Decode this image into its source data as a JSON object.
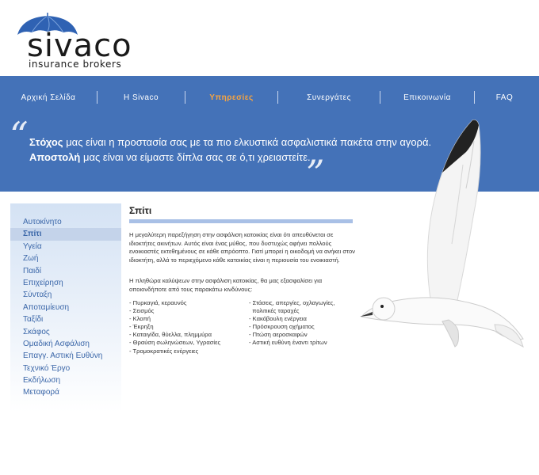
{
  "logo": {
    "brand": "sivaco",
    "tagline": "insurance brokers"
  },
  "nav": {
    "items": [
      {
        "label": "Αρχική Σελίδα",
        "active": false
      },
      {
        "label": "Η Sivaco",
        "active": false
      },
      {
        "label": "Υπηρεσίες",
        "active": true
      },
      {
        "label": "Συνεργάτες",
        "active": false
      },
      {
        "label": "Επικοινωνία",
        "active": false
      },
      {
        "label": "FAQ",
        "active": false
      }
    ]
  },
  "slogan": {
    "line1_bold": "Στόχος",
    "line1_rest": " μας είναι η προστασία σας με τα πιο ελκυστικά ασφαλιστικά πακέτα στην αγορά.",
    "line2_bold": "Αποστολή",
    "line2_rest": " μας είναι να είμαστε δίπλα σας σε ό,τι χρειαστείτε."
  },
  "sidebar": {
    "items": [
      {
        "label": "Αυτοκίνητο",
        "active": false
      },
      {
        "label": "Σπίτι",
        "active": true
      },
      {
        "label": "Υγεία",
        "active": false
      },
      {
        "label": "Ζωή",
        "active": false
      },
      {
        "label": "Παιδί",
        "active": false
      },
      {
        "label": "Επιχείρηση",
        "active": false
      },
      {
        "label": "Σύνταξη",
        "active": false
      },
      {
        "label": "Αποταμίευση",
        "active": false
      },
      {
        "label": "Ταξίδι",
        "active": false
      },
      {
        "label": "Σκάφος",
        "active": false
      },
      {
        "label": "Ομαδική Ασφάλιση",
        "active": false
      },
      {
        "label": "Επαγγ. Αστική Ευθύνη",
        "active": false
      },
      {
        "label": "Τεχνικό Έργο",
        "active": false
      },
      {
        "label": "Εκδήλωση",
        "active": false
      },
      {
        "label": "Μεταφορά",
        "active": false
      }
    ]
  },
  "content": {
    "title": "Σπίτι",
    "paragraph1": "Η μεγαλύτερη παρεξήγηση στην ασφάλιση κατοικίας είναι ότι απευθύνεται σε ιδιοκτήτες ακινήτων. Αυτός είναι ένας μύθος, που δυστυχώς αφήνει πολλούς ενοικιαστές εκτεθημένους σε κάθε απρόοπτο. Γιατί μπορεί η οικοδομή να ανήκει στον ιδιοκτήτη, αλλά το περιεχόμενο κάθε κατοικίας είναι η περιουσία του ενοικιαστή.",
    "paragraph2": "Η πληθώρα καλύψεων στην ασφάλιση κατοικίας, θα μας εξασφαλίσει για οποιονδήποτε από τους παρακάτω κινδύνους:",
    "risks_col1": [
      "- Πυρκαγιά, κεραυνός",
      "- Σεισμός",
      "- Κλοπή",
      "- Έκρηξη",
      "- Καταιγίδα, θύελλα, πλημμύρα",
      "- Θραύση σωληνώσεων, Υγρασίες",
      "- Τρομοκρατικές ενέργειες"
    ],
    "risks_col2": [
      "- Στάσεις, απεργίες, οχλαγωγίες,",
      "  πολιτικές ταραχές",
      "- Κακόβουλη ενέργεια",
      "- Πρόσκρουση οχήματος",
      "- Πτώση αεροσκαφών",
      "- Αστική ευθύνη έναντι τρίτων"
    ]
  },
  "colors": {
    "band": "#4472b8",
    "active_nav": "#f7a440",
    "sidebar_link": "#3a66a8",
    "title_bar": "#a9c0e6"
  }
}
